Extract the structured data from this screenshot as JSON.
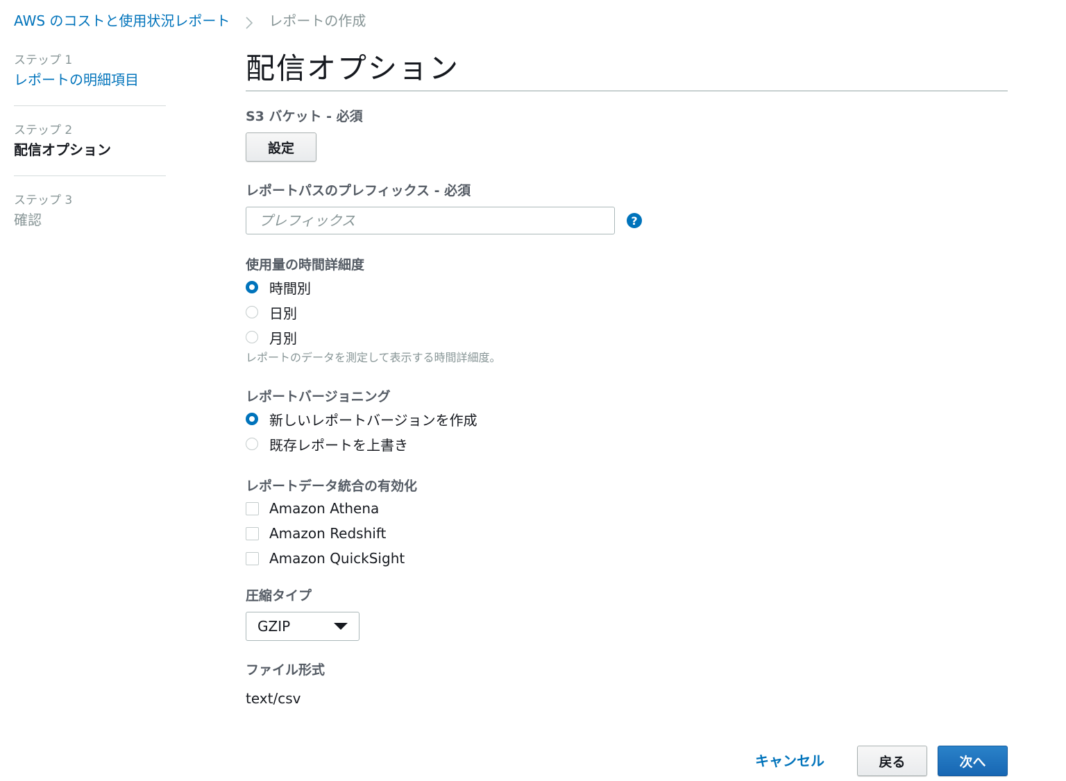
{
  "breadcrumb": {
    "parent": "AWS のコストと使用状況レポート",
    "separator_icon": "chevron-right-icon",
    "current": "レポートの作成"
  },
  "steps": [
    {
      "label": "ステップ 1",
      "title": "レポートの明細項目",
      "state": "link"
    },
    {
      "label": "ステップ 2",
      "title": "配信オプション",
      "state": "active"
    },
    {
      "label": "ステップ 3",
      "title": "確認",
      "state": "disabled"
    }
  ],
  "main": {
    "title": "配信オプション",
    "s3_bucket": {
      "label": "S3 バケット - 必須",
      "button_label": "設定"
    },
    "prefix": {
      "label": "レポートパスのプレフィックス - 必須",
      "value": "",
      "placeholder": "プレフィックス",
      "help_icon": "question-circle-icon",
      "help_glyph": "?"
    },
    "granularity": {
      "label": "使用量の時間詳細度",
      "options": [
        {
          "label": "時間別",
          "checked": true
        },
        {
          "label": "日別",
          "checked": false
        },
        {
          "label": "月別",
          "checked": false
        }
      ],
      "hint": "レポートのデータを測定して表示する時間詳細度。"
    },
    "versioning": {
      "label": "レポートバージョニング",
      "options": [
        {
          "label": "新しいレポートバージョンを作成",
          "checked": true
        },
        {
          "label": "既存レポートを上書き",
          "checked": false
        }
      ]
    },
    "integration": {
      "label": "レポートデータ統合の有効化",
      "options": [
        {
          "label": "Amazon Athena",
          "checked": false
        },
        {
          "label": "Amazon Redshift",
          "checked": false
        },
        {
          "label": "Amazon QuickSight",
          "checked": false
        }
      ]
    },
    "compression": {
      "label": "圧縮タイプ",
      "selected": "GZIP",
      "caret_icon": "caret-down-icon"
    },
    "file_format": {
      "label": "ファイル形式",
      "value": "text/csv"
    }
  },
  "footer": {
    "cancel_label": "キャンセル",
    "back_label": "戻る",
    "next_label": "次へ"
  },
  "colors": {
    "link": "#0073bb",
    "primary": "#1766b3",
    "muted": "#879596"
  }
}
